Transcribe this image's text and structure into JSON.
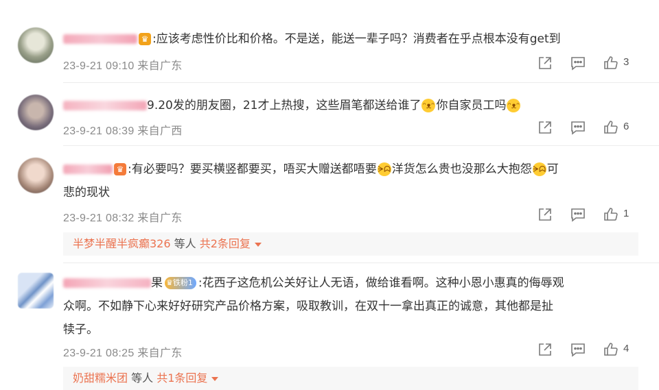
{
  "comments": [
    {
      "text": ":应该考虑性价比和价格。不是送，能送一辈子吗？消费者在乎点根本没有get到",
      "time": "23-9-21 09:10",
      "location": "来自广东",
      "likes": "3"
    },
    {
      "text_a": "9.20发的朋友圈，21才上热搜，这些眉笔都送给谁了",
      "text_b": "你自家员工吗",
      "time": "23-9-21 08:39",
      "location": "来自广西",
      "likes": "6"
    },
    {
      "text_a": ":有必要吗？要买横竖都要买，唔买大赠送都唔要",
      "text_b": "洋货怎么贵也没那么大抱怨",
      "text_c": "可",
      "text_d": "悲的现状",
      "time": "23-9-21 08:32",
      "location": "来自广东",
      "likes": "1",
      "replies": {
        "user": "半梦半醒半疯癫326",
        "mid": "等人",
        "count": "共2条回复"
      }
    },
    {
      "name_suffix": "果",
      "fan_badge": "铁粉1",
      "text_line1": ":花西子这危机公关好让人无语，做给谁看啊。这种小恩小惠真的侮辱观",
      "text_line2": "众啊。不如静下心来好好研究产品价格方案，吸取教训，在双十一拿出真正的诚意，其他都是扯",
      "text_line3": "犊子。",
      "time": "23-9-21 08:25",
      "location": "来自广东",
      "likes": "4",
      "replies": {
        "user": "奶甜糯米团",
        "mid": "等人",
        "count": "共1条回复"
      }
    }
  ],
  "icons": {
    "share": "share-icon",
    "comment": "comment-icon",
    "like": "thumbs-up-icon",
    "crown": "crown-badge-icon",
    "emoji_cat": "cat-emoji-icon",
    "emoji_laugh": "laugh-emoji-icon"
  },
  "colors": {
    "accent": "#eb7350",
    "meta": "#8a8a8a",
    "text": "#333333"
  }
}
